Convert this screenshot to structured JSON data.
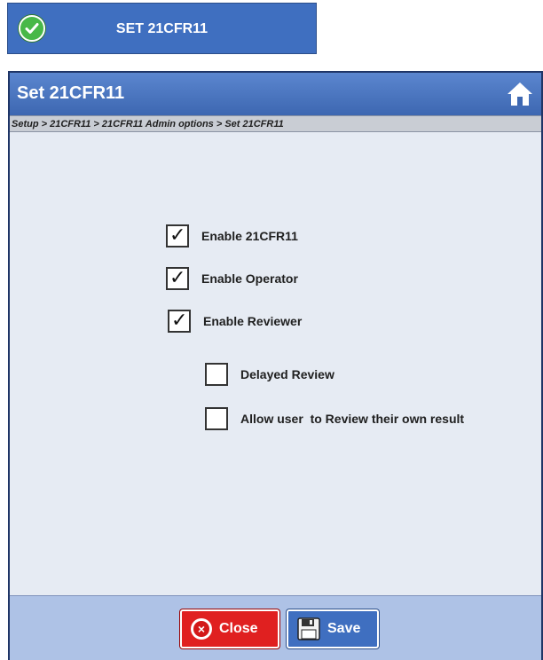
{
  "banner": {
    "title": "SET 21CFR11",
    "icon": "check-circle-icon"
  },
  "dialog": {
    "title": "Set 21CFR11",
    "home_icon": "home-icon",
    "breadcrumb": "Setup > 21CFR11 > 21CFR11 Admin options > Set 21CFR11"
  },
  "options": [
    {
      "label": "Enable 21CFR11",
      "checked": true
    },
    {
      "label": "Enable Operator",
      "checked": true
    },
    {
      "label": "Enable Reviewer",
      "checked": true
    },
    {
      "label": "Delayed Review",
      "checked": false
    },
    {
      "label": "Allow user  to Review their own result",
      "checked": false
    }
  ],
  "buttons": {
    "close_label": "Close",
    "save_label": "Save"
  },
  "colors": {
    "titlebar": "#4a76c2",
    "close_button": "#e02020",
    "save_button": "#3f6fc0",
    "footer": "#aec2e6"
  }
}
